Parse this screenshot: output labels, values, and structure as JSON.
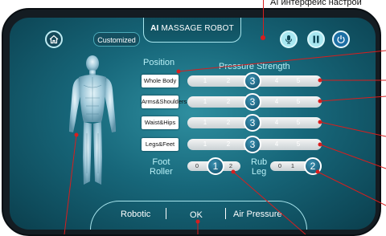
{
  "caption": "AI интерфейс настрой",
  "header": {
    "title_prefix": "AI",
    "title_rest": "MASSAGE ROBOT",
    "customized_label": "Customized"
  },
  "icons": {
    "home": "home-icon",
    "mic": "microphone-icon",
    "pause": "pause-icon",
    "power": "power-icon"
  },
  "labels": {
    "position": "Position",
    "pressure_strength": "Pressure Strength",
    "foot_roller_1": "Foot",
    "foot_roller_2": "Roller",
    "rub_leg_1": "Rub",
    "rub_leg_2": "Leg"
  },
  "positions": [
    {
      "label": "Whole Body",
      "levels": [
        "1",
        "2",
        "3",
        "4",
        "5"
      ],
      "selected": "3"
    },
    {
      "label": "Arms&Shoulders",
      "levels": [
        "1",
        "2",
        "3",
        "4",
        "5"
      ],
      "selected": "3"
    },
    {
      "label": "Waist&Hips",
      "levels": [
        "1",
        "2",
        "3",
        "4",
        "5"
      ],
      "selected": "3"
    },
    {
      "label": "Legs&Feet",
      "levels": [
        "1",
        "2",
        "3",
        "4",
        "5"
      ],
      "selected": "3"
    }
  ],
  "foot_roller": {
    "levels": [
      "0",
      "1",
      "2"
    ],
    "selected": "1"
  },
  "rub_leg": {
    "levels": [
      "0",
      "1",
      "2"
    ],
    "selected": "2"
  },
  "bottom": {
    "robotic": "Robotic",
    "ok": "OK",
    "air_pressure": "Air Pressure"
  },
  "colors": {
    "screen": "#17677a",
    "knob": "#0f4f69",
    "leader_lines": "#d81e1e"
  }
}
